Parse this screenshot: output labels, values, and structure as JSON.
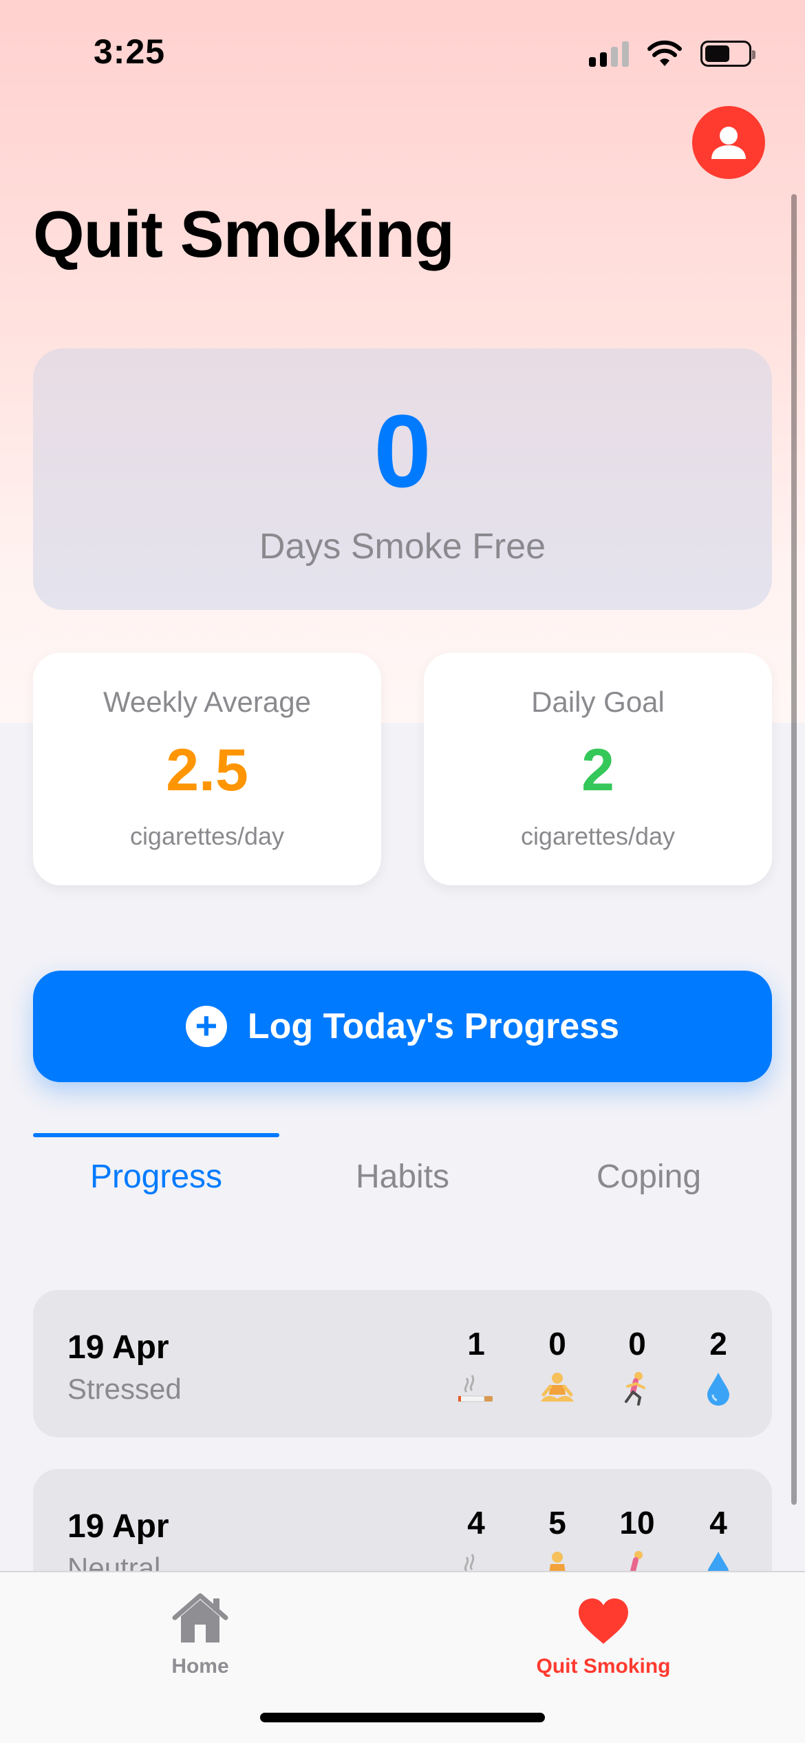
{
  "status_bar": {
    "time": "3:25",
    "signal_icon": "cellular-signal-icon",
    "wifi_icon": "wifi-icon",
    "battery_icon": "battery-icon",
    "battery_level": 0.58
  },
  "header": {
    "title": "Quit Smoking",
    "profile_icon": "person-icon",
    "profile_color": "#FF3B30"
  },
  "hero": {
    "value": "0",
    "label": "Days Smoke Free",
    "value_color": "#007AFF"
  },
  "stats": [
    {
      "title": "Weekly Average",
      "value": "2.5",
      "unit": "cigarettes/day",
      "color": "#FF9500"
    },
    {
      "title": "Daily Goal",
      "value": "2",
      "unit": "cigarettes/day",
      "color": "#34C759"
    }
  ],
  "log_button": {
    "label": "Log Today's Progress",
    "icon": "plus-circle-icon",
    "color": "#007AFF"
  },
  "segments": {
    "items": [
      "Progress",
      "Habits",
      "Coping"
    ],
    "selected": "Progress"
  },
  "entries": [
    {
      "date": "19 Apr",
      "mood": "Stressed",
      "metrics": [
        {
          "value": "1",
          "icon": "cigarette-icon"
        },
        {
          "value": "0",
          "icon": "meditation-icon"
        },
        {
          "value": "0",
          "icon": "running-icon"
        },
        {
          "value": "2",
          "icon": "water-drop-icon"
        }
      ]
    },
    {
      "date": "19 Apr",
      "mood": "Neutral",
      "metrics": [
        {
          "value": "4",
          "icon": "cigarette-icon"
        },
        {
          "value": "5",
          "icon": "meditation-icon"
        },
        {
          "value": "10",
          "icon": "running-icon"
        },
        {
          "value": "4",
          "icon": "water-drop-icon"
        }
      ]
    }
  ],
  "tab_bar": {
    "items": [
      {
        "label": "Home",
        "icon": "house-icon",
        "selected": false
      },
      {
        "label": "Quit Smoking",
        "icon": "heart-icon",
        "selected": true
      }
    ],
    "selected_color": "#FF3B30",
    "unselected_color": "#8E8E93"
  }
}
